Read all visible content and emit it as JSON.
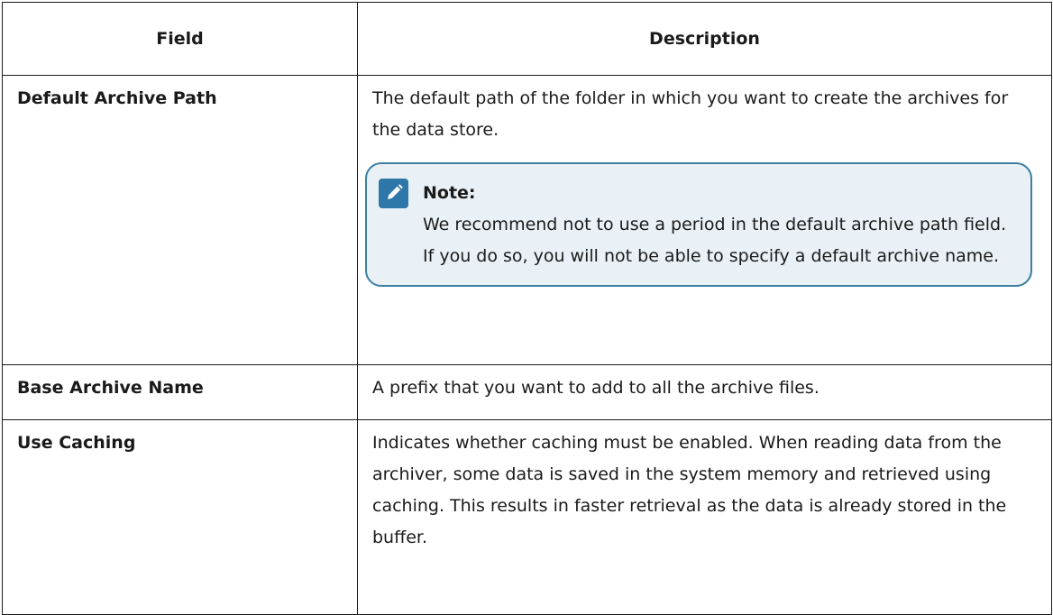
{
  "table": {
    "headers": [
      "Field",
      "Description"
    ],
    "rows": [
      {
        "field": "Default Archive Path",
        "description": "The default path of the folder in which you want to create the archives for the data store.",
        "note": {
          "title": "Note:",
          "text": "We recommend not to use a period in the default archive path field. If you do so, you will not be able to specify a default archive name.",
          "icon": "pencil-icon"
        }
      },
      {
        "field": "Base Archive Name",
        "description": "A prefix that you want to add to all the archive files."
      },
      {
        "field": "Use Caching",
        "description": "Indicates whether caching must be enabled. When reading data from the archiver, some data is saved in the system memory and retrieved using caching. This results in faster retrieval as the data is already stored in the buffer."
      }
    ]
  },
  "colors": {
    "note_border": "#3d7ea2",
    "note_background": "#e9f1f6",
    "note_icon": "#2d78a8"
  }
}
